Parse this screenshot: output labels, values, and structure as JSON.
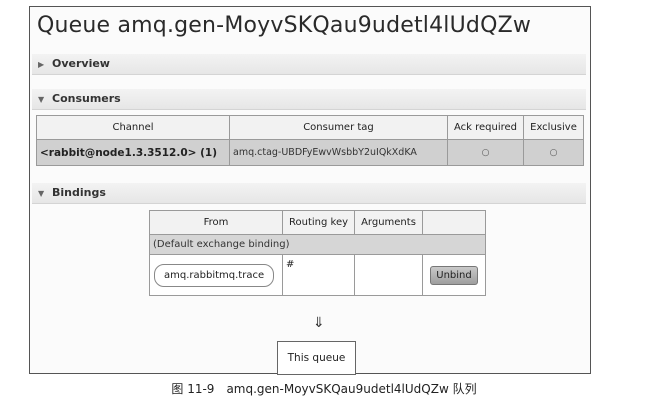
{
  "queue_page": {
    "title": "Queue amq.gen-MoyvSKQau9udetl4lUdQZw"
  },
  "overview": {
    "toggle_icon": "triangle-right",
    "label": "Overview"
  },
  "consumers": {
    "toggle_icon": "triangle-down",
    "label": "Consumers",
    "columns": [
      "Channel",
      "Consumer tag",
      "Ack required",
      "Exclusive"
    ],
    "rows": [
      {
        "channel": "<rabbit@node1.3.3512.0> (1)",
        "consumer_tag": "amq.ctag-UBDFyEwvWsbbY2uIQkXdKA",
        "ack_required": "○",
        "exclusive": "○"
      }
    ]
  },
  "bindings": {
    "toggle_icon": "triangle-down",
    "label": "Bindings",
    "columns": [
      "From",
      "Routing key",
      "Arguments",
      ""
    ],
    "default_binding": "(Default exchange binding)",
    "rows": [
      {
        "from": "amq.rabbitmq.trace",
        "routing_key": "#",
        "arguments": "",
        "unbind_label": "Unbind"
      }
    ],
    "arrow_glyph": "⇓",
    "this_queue_label": "This queue"
  },
  "caption": "图 11-9　amq.gen-MoyvSKQau9udetl4lUdQZw 队列"
}
